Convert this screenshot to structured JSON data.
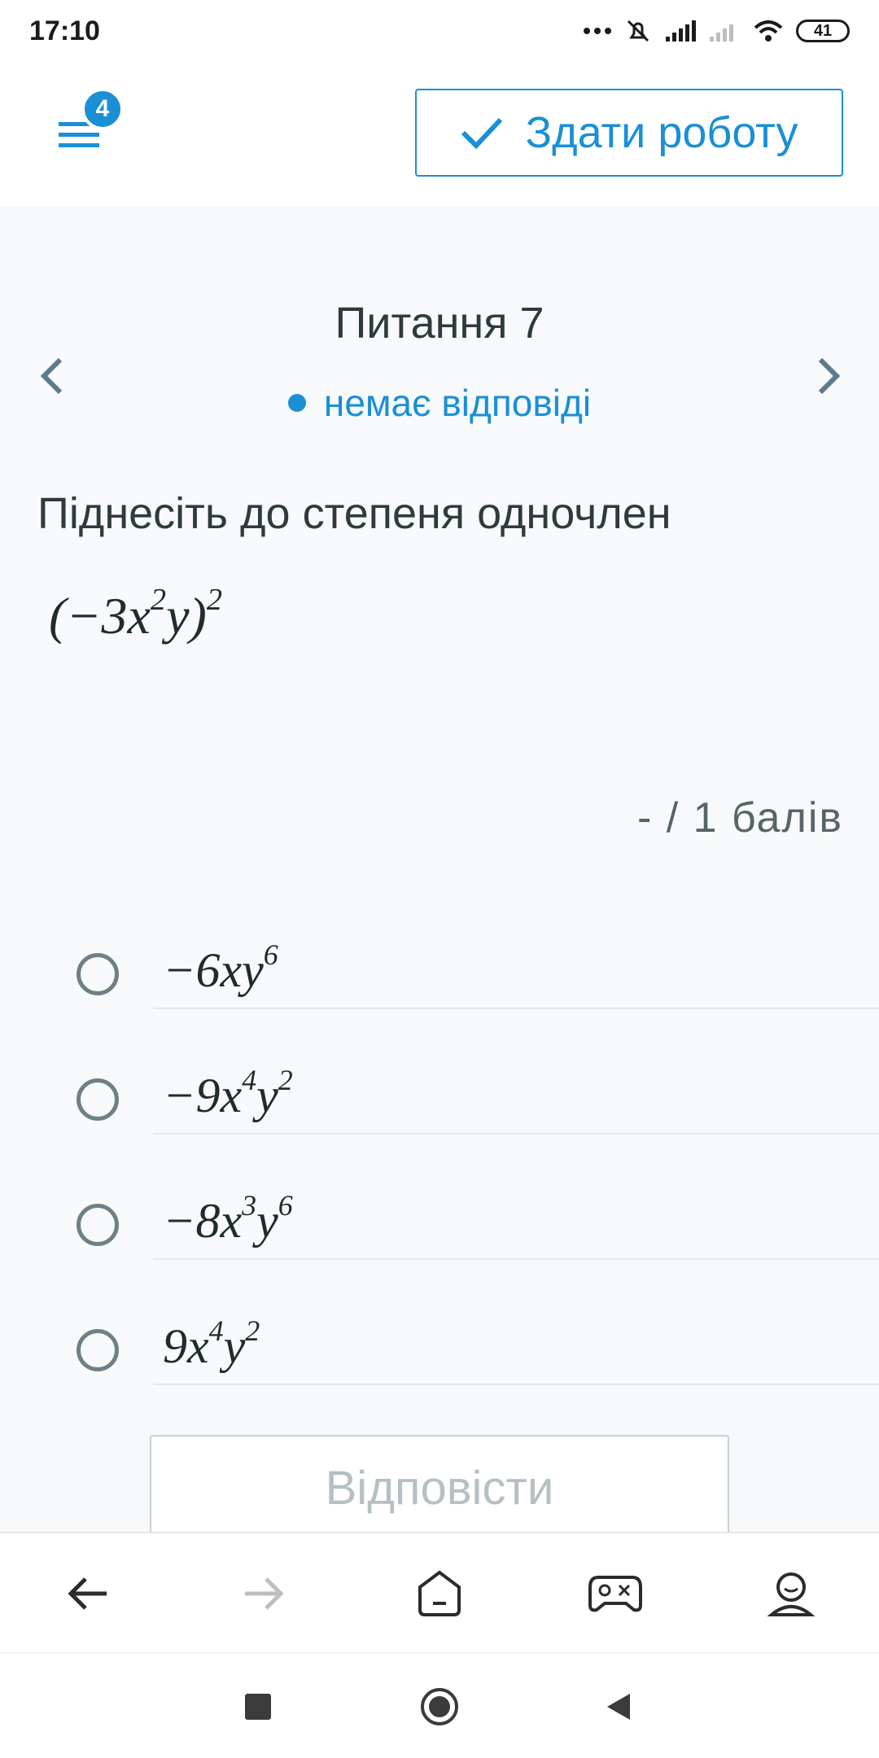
{
  "status_bar": {
    "time": "17:10",
    "battery": "41"
  },
  "header": {
    "menu_badge": "4",
    "submit_label": "Здати роботу"
  },
  "question": {
    "title": "Питання 7",
    "status": "немає відповіді",
    "prompt": "Піднесіть до степеня одночлен",
    "expression": {
      "base": "(−3x",
      "exp1": "2",
      "mid": "y)",
      "exp2": "2"
    },
    "points": "- / 1 балів"
  },
  "options": [
    {
      "parts": [
        "−6xy",
        "6"
      ]
    },
    {
      "parts": [
        "−9x",
        "4",
        "y",
        "2"
      ]
    },
    {
      "parts": [
        "−8x",
        "3",
        "y",
        "6"
      ]
    },
    {
      "parts": [
        "9x",
        "4",
        "y",
        "2"
      ]
    }
  ],
  "answer_button": "Відповісти",
  "colors": {
    "accent": "#1a8fd6",
    "text": "#2f3a3e",
    "muted": "#b5c0c5"
  },
  "browser_nav": [
    "back-icon",
    "forward-icon",
    "home-icon",
    "game-icon",
    "profile-icon"
  ],
  "system_nav": [
    "recents-icon",
    "home-circle-icon",
    "back-triangle-icon"
  ]
}
